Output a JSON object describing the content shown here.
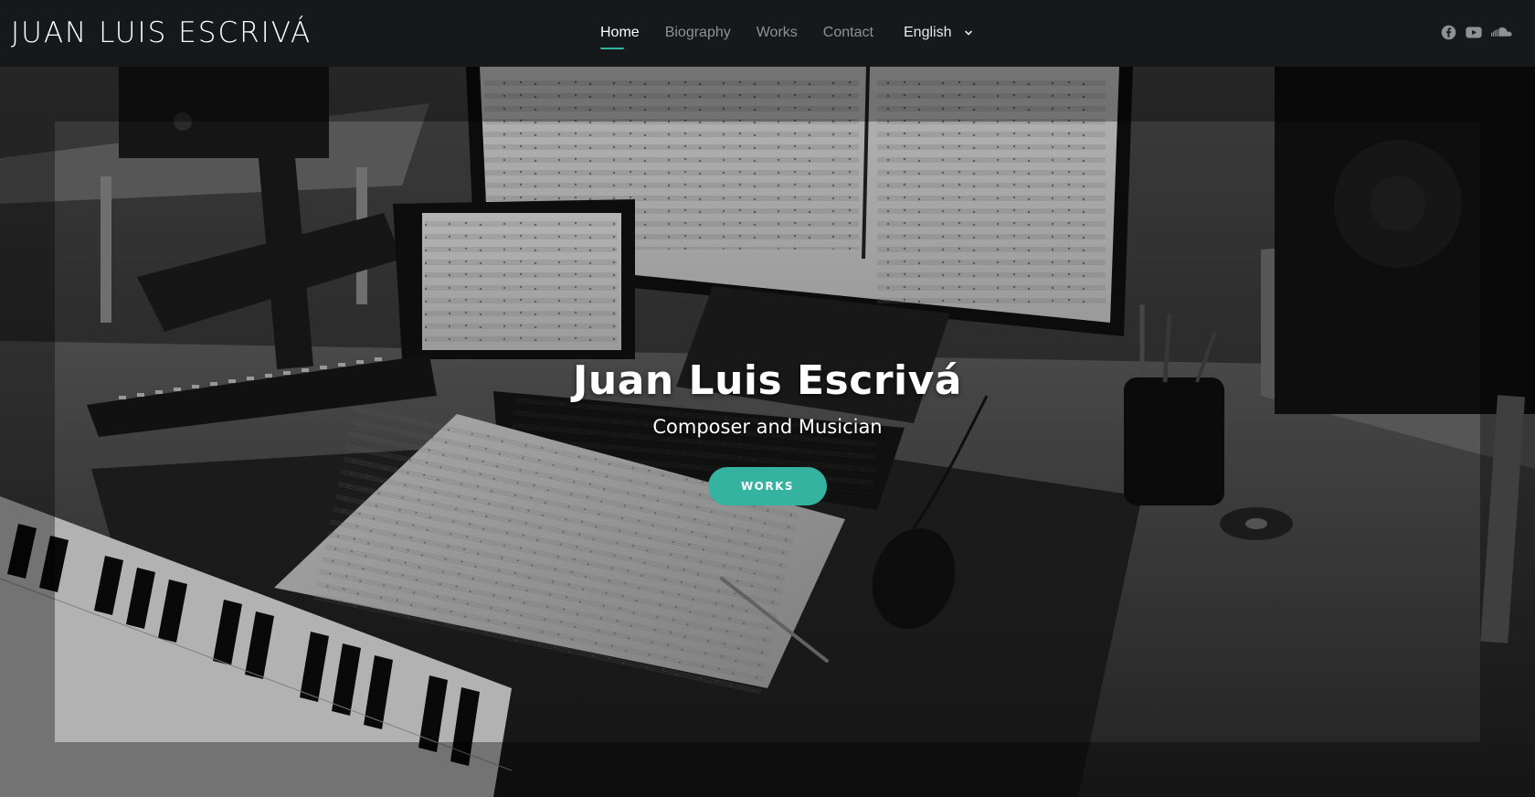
{
  "header": {
    "brand": "JUAN LUIS ESCRIVÁ",
    "nav": [
      {
        "label": "Home",
        "active": true
      },
      {
        "label": "Biography",
        "active": false
      },
      {
        "label": "Works",
        "active": false
      },
      {
        "label": "Contact",
        "active": false
      }
    ],
    "language": {
      "selected": "English",
      "icon": "chevron-down-icon"
    },
    "socials": [
      {
        "icon": "facebook-icon"
      },
      {
        "icon": "youtube-icon"
      },
      {
        "icon": "soundcloud-icon"
      }
    ]
  },
  "hero": {
    "title": "Juan Luis Escrivá",
    "subtitle": "Composer and Musician",
    "button_label": "WORKS"
  },
  "colors": {
    "header_bg": "#16191b",
    "accent": "#34b3a0",
    "nav_inactive": "#8e9296",
    "nav_active": "#ffffff"
  }
}
